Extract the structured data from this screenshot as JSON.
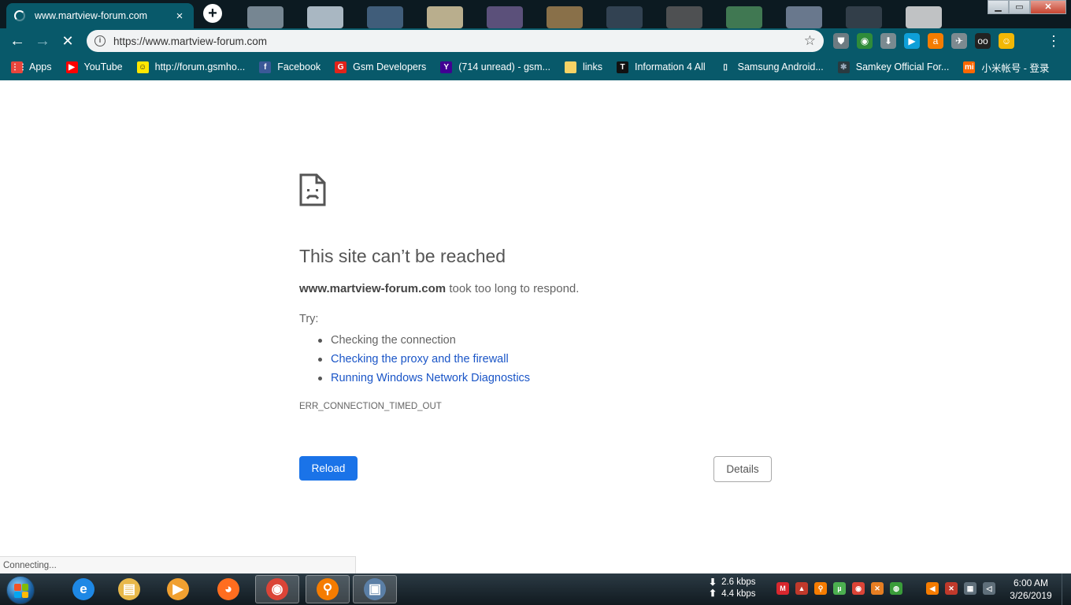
{
  "browser": {
    "tab": {
      "title": "www.martview-forum.com",
      "close": "×"
    },
    "new_tab": "+",
    "window_controls": {
      "minimize": "▁",
      "maximize": "▭",
      "close": "✕"
    },
    "toolbar": {
      "back": "←",
      "forward": "→",
      "stop": "✕",
      "url": "https://www.martview-forum.com",
      "info": "i",
      "star": "☆",
      "menu": "⋮"
    },
    "extensions": [
      {
        "name": "shield-extension-icon",
        "glyph": "⛊",
        "color": "#6d7b82"
      },
      {
        "name": "globe-extension-icon",
        "glyph": "◉",
        "color": "#2f8b3a"
      },
      {
        "name": "download-extension-icon",
        "glyph": "⬇",
        "color": "#7a8a90"
      },
      {
        "name": "cast-extension-icon",
        "glyph": "▶",
        "color": "#0e9fd8"
      },
      {
        "name": "bag-extension-icon",
        "glyph": "a",
        "color": "#f57c00"
      },
      {
        "name": "satellite-extension-icon",
        "glyph": "✈",
        "color": "#7d8a90"
      },
      {
        "name": "glasses-extension-icon",
        "glyph": "oo",
        "color": "#222222"
      },
      {
        "name": "profile-avatar-icon",
        "glyph": "☺",
        "color": "#f2b705"
      }
    ],
    "bookmarks": [
      {
        "label": "Apps",
        "icon": "apps-grid-icon",
        "glyph": "⋮⋮",
        "bg": "#e8453c",
        "fg": "#fff"
      },
      {
        "label": "YouTube",
        "icon": "youtube-icon",
        "glyph": "▶",
        "bg": "#ff0000",
        "fg": "#fff"
      },
      {
        "label": "http://forum.gsmho...",
        "icon": "smiley-icon",
        "glyph": "☺",
        "bg": "#ffe600",
        "fg": "#222"
      },
      {
        "label": "Facebook",
        "icon": "facebook-icon",
        "glyph": "f",
        "bg": "#3b5998",
        "fg": "#fff"
      },
      {
        "label": "Gsm Developers",
        "icon": "gsm-developers-icon",
        "glyph": "G",
        "bg": "#e2231a",
        "fg": "#fff"
      },
      {
        "label": "(714 unread) - gsm...",
        "icon": "yahoo-icon",
        "glyph": "Y",
        "bg": "#410093",
        "fg": "#fff"
      },
      {
        "label": "links",
        "icon": "folder-icon",
        "glyph": "",
        "bg": "#f6d365",
        "fg": "#fff"
      },
      {
        "label": "Information 4 All",
        "icon": "t-logo-icon",
        "glyph": "T",
        "bg": "#111",
        "fg": "#fff"
      },
      {
        "label": "Samsung Android...",
        "icon": "page-icon",
        "glyph": "▯",
        "bg": "transparent",
        "fg": "#fff"
      },
      {
        "label": "Samkey Official For...",
        "icon": "samkey-icon",
        "glyph": "✱",
        "bg": "#2a3a40",
        "fg": "#9ab"
      },
      {
        "label": "小米帐号 - 登录",
        "icon": "mi-icon",
        "glyph": "mi",
        "bg": "#ff6700",
        "fg": "#fff"
      }
    ],
    "status": "Connecting..."
  },
  "error_page": {
    "title": "This site can’t be reached",
    "host": "www.martview-forum.com",
    "message": " took too long to respond.",
    "try_label": "Try:",
    "suggestions": [
      {
        "text": "Checking the connection",
        "link": false
      },
      {
        "text": "Checking the proxy and the firewall",
        "link": true
      },
      {
        "text": "Running Windows Network Diagnostics",
        "link": true
      }
    ],
    "error_code": "ERR_CONNECTION_TIMED_OUT",
    "reload_label": "Reload",
    "details_label": "Details"
  },
  "taskbar": {
    "apps": [
      {
        "name": "internet-explorer-icon",
        "glyph": "e",
        "bg": "#1e88e5",
        "active": false
      },
      {
        "name": "file-explorer-icon",
        "glyph": "▤",
        "bg": "#e8b84a",
        "active": false
      },
      {
        "name": "media-player-icon",
        "glyph": "▶",
        "bg": "#f0a030",
        "active": false
      },
      {
        "name": "firefox-icon",
        "glyph": "◕",
        "bg": "#ff6d1f",
        "active": false
      },
      {
        "name": "chrome-icon",
        "glyph": "◉",
        "bg": "#db4437",
        "active": true
      },
      {
        "name": "search-tool-icon",
        "glyph": "⚲",
        "bg": "#f57c00",
        "active": true
      },
      {
        "name": "remote-desktop-icon",
        "glyph": "▣",
        "bg": "#5b7fa6",
        "active": true
      }
    ],
    "net_down": "2.6 kbps",
    "net_up": "4.4 kbps",
    "tray": [
      {
        "name": "mega-tray-icon",
        "glyph": "M",
        "bg": "#d9272e"
      },
      {
        "name": "arrow-tray-icon",
        "glyph": "▲",
        "bg": "#c0392b"
      },
      {
        "name": "search-tray-icon",
        "glyph": "⚲",
        "bg": "#f57c00"
      },
      {
        "name": "utorrent-tray-icon",
        "glyph": "µ",
        "bg": "#4caf50"
      },
      {
        "name": "chrome-tray-icon",
        "glyph": "◉",
        "bg": "#db4437"
      },
      {
        "name": "tool-tray-icon",
        "glyph": "✕",
        "bg": "#e67e22"
      },
      {
        "name": "network-globe-tray-icon",
        "glyph": "◍",
        "bg": "#3a9d3a"
      }
    ],
    "system": [
      {
        "name": "speaker-tray-icon",
        "glyph": "◀",
        "bg": "#f57c00"
      },
      {
        "name": "flag-error-tray-icon",
        "glyph": "✕",
        "bg": "#c0392b"
      },
      {
        "name": "network-tray-icon",
        "glyph": "▦",
        "bg": "#5f6f7a"
      },
      {
        "name": "volume-tray-icon",
        "glyph": "◁",
        "bg": "#5f6f7a"
      }
    ],
    "time": "6:00 AM",
    "date": "3/26/2019"
  }
}
